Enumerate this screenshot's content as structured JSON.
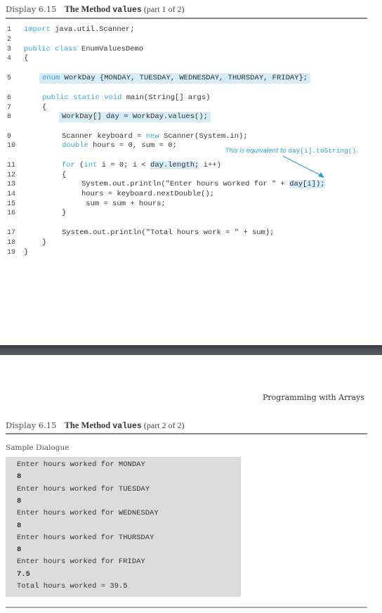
{
  "part1": {
    "caption": {
      "display": "Display 6.15",
      "title_prefix": "The Method",
      "title_code": "values",
      "part": "(part 1 of 2)"
    },
    "code_lines": [
      {
        "n": "1",
        "segments": [
          {
            "t": "import",
            "k": true
          },
          {
            "t": " java.util.Scanner;"
          }
        ]
      },
      {
        "n": "2",
        "segments": []
      },
      {
        "n": "3",
        "segments": [
          {
            "t": "public class",
            "k": true
          },
          {
            "t": " EnumValuesDemo"
          }
        ]
      },
      {
        "n": "4",
        "segments": [
          {
            "t": "{"
          }
        ]
      },
      {
        "n": "5",
        "segments": [
          {
            "t": "enum",
            "k": true
          },
          {
            "t": " WorkDay {MONDAY, TUESDAY, WEDNESDAY, THURSDAY, FRIDAY};"
          }
        ],
        "highlight": true
      },
      {
        "n": "6",
        "segments": [
          {
            "t": "public static void",
            "k": true
          },
          {
            "t": " main(String[] args)"
          }
        ]
      },
      {
        "n": "7",
        "segments": [
          {
            "t": "{"
          }
        ]
      },
      {
        "n": "8",
        "segments": [
          {
            "t": "WorkDay[] day = WorkDay.values();"
          }
        ],
        "highlight": true
      },
      {
        "n": "9",
        "segments": [
          {
            "t": "Scanner keyboard = "
          },
          {
            "t": "new",
            "k": true
          },
          {
            "t": " Scanner(System.in);"
          }
        ]
      },
      {
        "n": "10",
        "segments": [
          {
            "t": "double",
            "k": true
          },
          {
            "t": " hours = 0, sum = 0;"
          }
        ]
      },
      {
        "n": "11",
        "segments": [
          {
            "t": "for",
            "k": true
          },
          {
            "t": " ("
          },
          {
            "t": "int",
            "k": true
          },
          {
            "t": " i = 0; i < "
          },
          {
            "t": "day.length;",
            "h": true
          },
          {
            "t": " i++)"
          }
        ]
      },
      {
        "n": "12",
        "segments": [
          {
            "t": "{"
          }
        ]
      },
      {
        "n": "13",
        "segments": [
          {
            "t": "System.out.println(\"Enter hours worked for \" + "
          },
          {
            "t": "day[i]);",
            "h": true
          }
        ]
      },
      {
        "n": "14",
        "segments": [
          {
            "t": "hours = keyboard.nextDouble();"
          }
        ]
      },
      {
        "n": "15",
        "segments": [
          {
            "t": " sum = sum + hours;"
          }
        ]
      },
      {
        "n": "16",
        "segments": [
          {
            "t": "}"
          }
        ]
      },
      {
        "n": "17",
        "segments": [
          {
            "t": "System.out.println(\"Total hours work = \" + sum);"
          }
        ]
      },
      {
        "n": "18",
        "segments": [
          {
            "t": "}"
          }
        ]
      },
      {
        "n": "19",
        "segments": [
          {
            "t": "}"
          }
        ]
      }
    ],
    "annotation": {
      "text": "This is equivalent to ",
      "code": "day[i].toString()",
      "end": "."
    }
  },
  "running_head": "Programming with Arrays",
  "part2": {
    "caption": {
      "display": "Display 6.15",
      "title_prefix": "The Method",
      "title_code": "values",
      "part": "(part 2 of 2)"
    },
    "sample_label": "Sample Dialogue",
    "dialogue": [
      {
        "text": "Enter hours worked for MONDAY",
        "input": false
      },
      {
        "text": "8",
        "input": true
      },
      {
        "text": "Enter hours worked for TUESDAY",
        "input": false
      },
      {
        "text": "8",
        "input": true
      },
      {
        "text": "Enter hours worked for WEDNESDAY",
        "input": false
      },
      {
        "text": "8",
        "input": true
      },
      {
        "text": "Enter hours worked for THURSDAY",
        "input": false
      },
      {
        "text": "8",
        "input": true
      },
      {
        "text": "Enter hours worked for FRIDAY",
        "input": false
      },
      {
        "text": "7.5",
        "input": true
      },
      {
        "text": "Total hours worked = 39.5",
        "input": false
      }
    ]
  },
  "colors": {
    "keyword": "#3aa6dc",
    "highlight": "#d6ecf7",
    "annotation": "#2a9fd6",
    "dialogue_bg": "#dcdcdc"
  }
}
